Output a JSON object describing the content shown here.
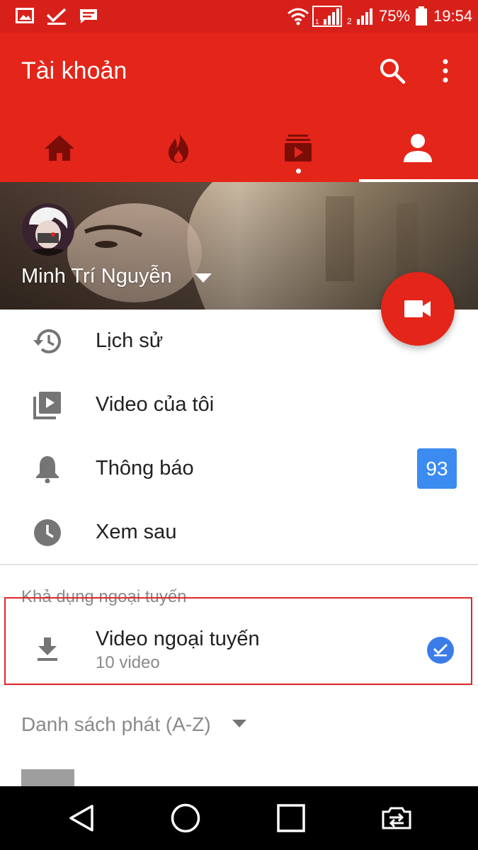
{
  "status_bar": {
    "battery": "75%",
    "time": "19:54",
    "left_icons": [
      "gallery-icon",
      "checkmark-icon",
      "message-icon"
    ],
    "right_icons": [
      "wifi-icon",
      "signal-icon",
      "signal-icon",
      "battery-icon"
    ]
  },
  "app_bar": {
    "title": "Tài khoản",
    "actions": [
      "search-icon",
      "more-vert-icon"
    ]
  },
  "tabs": [
    {
      "icon": "home-icon",
      "active": false
    },
    {
      "icon": "trending-icon",
      "active": false
    },
    {
      "icon": "subscriptions-icon",
      "active": false,
      "has_dot": true
    },
    {
      "icon": "account-icon",
      "active": true
    }
  ],
  "profile": {
    "name": "Minh Trí Nguyễn"
  },
  "menu": [
    {
      "icon": "history-icon",
      "label": "Lịch sử"
    },
    {
      "icon": "my-videos-icon",
      "label": "Video của tôi"
    },
    {
      "icon": "bell-icon",
      "label": "Thông báo",
      "badge": "93"
    },
    {
      "icon": "clock-icon",
      "label": "Xem sau"
    }
  ],
  "offline": {
    "section_title": "Khả dụng ngoại tuyến",
    "item_title": "Video ngoại tuyến",
    "item_subtitle": "10 video"
  },
  "playlists": {
    "sort_label": "Danh sách phát (A-Z)"
  },
  "colors": {
    "accent": "#e42519",
    "status_bar": "#d8201a",
    "badge": "#3b8bf0",
    "highlight": "#e0262a"
  },
  "nav_bar": [
    "back-icon",
    "home-circle-icon",
    "recents-icon",
    "switch-app-icon"
  ]
}
